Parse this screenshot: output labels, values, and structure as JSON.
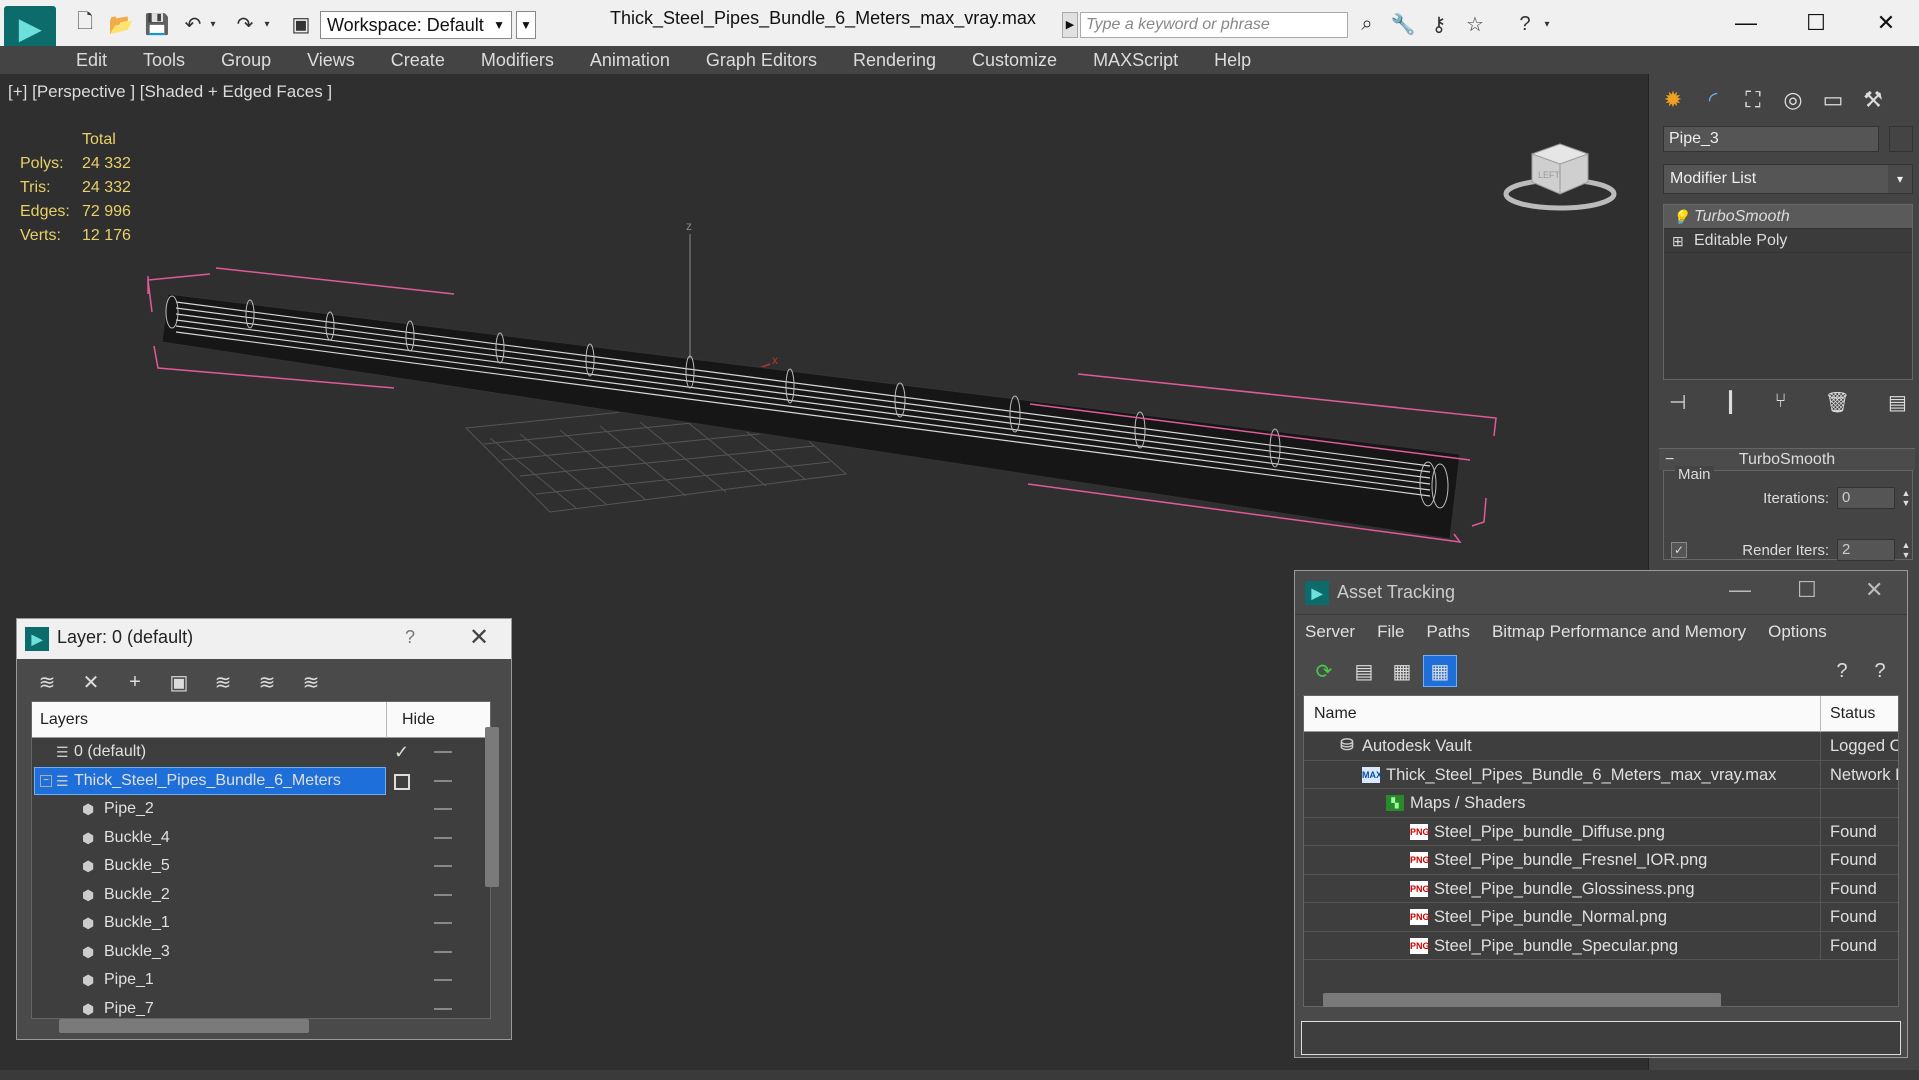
{
  "titlebar": {
    "workspace": "Workspace: Default",
    "doc_title": "Thick_Steel_Pipes_Bundle_6_Meters_max_vray.max",
    "search_placeholder": "Type a keyword or phrase",
    "icons": [
      "new-file-icon",
      "open-folder-icon",
      "save-icon",
      "undo-icon",
      "redo-icon",
      "project-icon",
      "binoculars-icon",
      "wrench-icon",
      "key-icon",
      "star-icon",
      "help-icon"
    ]
  },
  "menubar": {
    "items": [
      "Edit",
      "Tools",
      "Group",
      "Views",
      "Create",
      "Modifiers",
      "Animation",
      "Graph Editors",
      "Rendering",
      "Customize",
      "MAXScript",
      "Help"
    ]
  },
  "viewport": {
    "label": "[+] [Perspective ] [Shaded + Edged Faces ]",
    "stats": {
      "header": "Total",
      "rows": [
        {
          "k": "Polys:",
          "v": "24 332"
        },
        {
          "k": "Tris:",
          "v": "24 332"
        },
        {
          "k": "Edges:",
          "v": "72 996"
        },
        {
          "k": "Verts:",
          "v": "12 176"
        }
      ]
    },
    "axis_z": "z",
    "axis_x": "x",
    "viewcube_label": "LEFT"
  },
  "command_panel": {
    "object_name": "Pipe_3",
    "modifier_list": "Modifier List",
    "stack": [
      {
        "label": "TurboSmooth",
        "selected": true
      },
      {
        "label": "Editable Poly",
        "selected": false
      }
    ],
    "rollout_title": "TurboSmooth",
    "group_label": "Main",
    "iterations_label": "Iterations:",
    "iterations_value": "0",
    "render_iters_label": "Render Iters:",
    "render_iters_value": "2"
  },
  "layer_dialog": {
    "title": "Layer: 0 (default)",
    "help": "?",
    "header_layers": "Layers",
    "header_hide": "Hide",
    "rows": [
      {
        "name": "0 (default)",
        "indent": 1,
        "type": "layer"
      },
      {
        "name": "Thick_Steel_Pipes_Bundle_6_Meters",
        "indent": 1,
        "type": "layer",
        "selected": true
      },
      {
        "name": "Pipe_2",
        "indent": 2,
        "type": "object"
      },
      {
        "name": "Buckle_4",
        "indent": 2,
        "type": "object"
      },
      {
        "name": "Buckle_5",
        "indent": 2,
        "type": "object"
      },
      {
        "name": "Buckle_2",
        "indent": 2,
        "type": "object"
      },
      {
        "name": "Buckle_1",
        "indent": 2,
        "type": "object"
      },
      {
        "name": "Buckle_3",
        "indent": 2,
        "type": "object"
      },
      {
        "name": "Pipe_1",
        "indent": 2,
        "type": "object"
      },
      {
        "name": "Pipe_7",
        "indent": 2,
        "type": "object"
      }
    ]
  },
  "asset_dialog": {
    "title": "Asset Tracking",
    "menu": [
      "Server",
      "File",
      "Paths",
      "Bitmap Performance and Memory",
      "Options"
    ],
    "header_name": "Name",
    "header_status": "Status",
    "rows": [
      {
        "name": "Autodesk Vault",
        "status": "Logged Ou",
        "icon": "vault",
        "indent": 1
      },
      {
        "name": "Thick_Steel_Pipes_Bundle_6_Meters_max_vray.max",
        "status": "Network P",
        "icon": "max",
        "indent": 2
      },
      {
        "name": "Maps / Shaders",
        "status": "",
        "icon": "maps",
        "indent": 3
      },
      {
        "name": "Steel_Pipe_bundle_Diffuse.png",
        "status": "Found",
        "icon": "png",
        "indent": 4
      },
      {
        "name": "Steel_Pipe_bundle_Fresnel_IOR.png",
        "status": "Found",
        "icon": "png",
        "indent": 4
      },
      {
        "name": "Steel_Pipe_bundle_Glossiness.png",
        "status": "Found",
        "icon": "png",
        "indent": 4
      },
      {
        "name": "Steel_Pipe_bundle_Normal.png",
        "status": "Found",
        "icon": "png",
        "indent": 4
      },
      {
        "name": "Steel_Pipe_bundle_Specular.png",
        "status": "Found",
        "icon": "png",
        "indent": 4
      }
    ]
  },
  "colors": {
    "accent": "#1e6fd9",
    "stats_text": "#e8d06a",
    "bbox_pink": "#e05a9a",
    "app_teal": "#0c6b6b"
  }
}
